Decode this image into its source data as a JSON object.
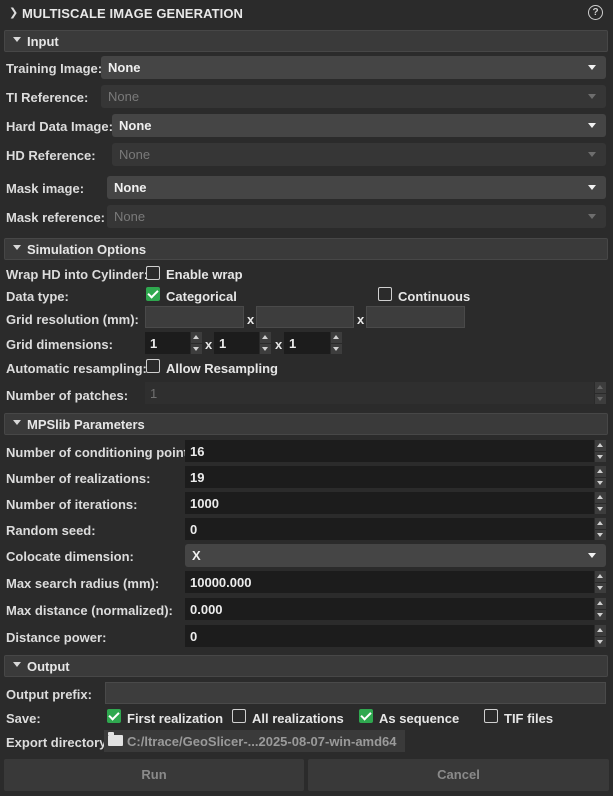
{
  "header": {
    "title": "MULTISCALE IMAGE GENERATION",
    "help": "?"
  },
  "input": {
    "section": "Input",
    "training_image_label": "Training Image:",
    "training_image_value": "None",
    "ti_reference_label": "TI Reference:",
    "ti_reference_value": "None",
    "hard_data_label": "Hard Data Image:",
    "hard_data_value": "None",
    "hd_reference_label": "HD Reference:",
    "hd_reference_value": "None",
    "mask_image_label": "Mask image:",
    "mask_image_value": "None",
    "mask_reference_label": "Mask reference:",
    "mask_reference_value": "None"
  },
  "simulation": {
    "section": "Simulation Options",
    "wrap_label": "Wrap HD into Cylinder:",
    "wrap_checkbox": "Enable wrap",
    "wrap_checked": false,
    "data_type_label": "Data type:",
    "categorical": "Categorical",
    "categorical_checked": true,
    "continuous": "Continuous",
    "continuous_checked": false,
    "grid_resolution_label": "Grid resolution (mm):",
    "res_x": "",
    "res_y": "",
    "res_z": "",
    "x_sep": "x",
    "grid_dimensions_label": "Grid dimensions:",
    "dim_x": "1",
    "dim_y": "1",
    "dim_z": "1",
    "resampling_label": "Automatic resampling:",
    "resampling_checkbox": "Allow Resampling",
    "resampling_checked": false,
    "patches_label": "Number of patches:",
    "patches_value": "1"
  },
  "mpslib": {
    "section": "MPSlib Parameters",
    "cond_points_label": "Number of conditioning points:",
    "cond_points_value": "16",
    "realizations_label": "Number of realizations:",
    "realizations_value": "19",
    "iterations_label": "Number of iterations:",
    "iterations_value": "1000",
    "seed_label": "Random seed:",
    "seed_value": "0",
    "colocate_label": "Colocate dimension:",
    "colocate_value": "X",
    "search_radius_label": "Max search radius (mm):",
    "search_radius_value": "10000.000",
    "max_distance_label": "Max distance (normalized):",
    "max_distance_value": "0.000",
    "distance_power_label": "Distance power:",
    "distance_power_value": "0"
  },
  "output": {
    "section": "Output",
    "prefix_label": "Output prefix:",
    "prefix_value": "",
    "save_label": "Save:",
    "first_realization": "First realization",
    "first_checked": true,
    "all_realizations": "All realizations",
    "all_checked": false,
    "as_sequence": "As sequence",
    "sequence_checked": true,
    "tif_files": "TIF files",
    "tif_checked": false,
    "export_dir_label": "Export directory:",
    "export_dir_value": "C:/ltrace/GeoSlicer-...2025-08-07-win-amd64"
  },
  "buttons": {
    "run": "Run",
    "cancel": "Cancel"
  },
  "colors": {
    "background": "#2b2b2b",
    "check_accent": "#2fa84f",
    "field_bg": "#1c1c1c"
  }
}
